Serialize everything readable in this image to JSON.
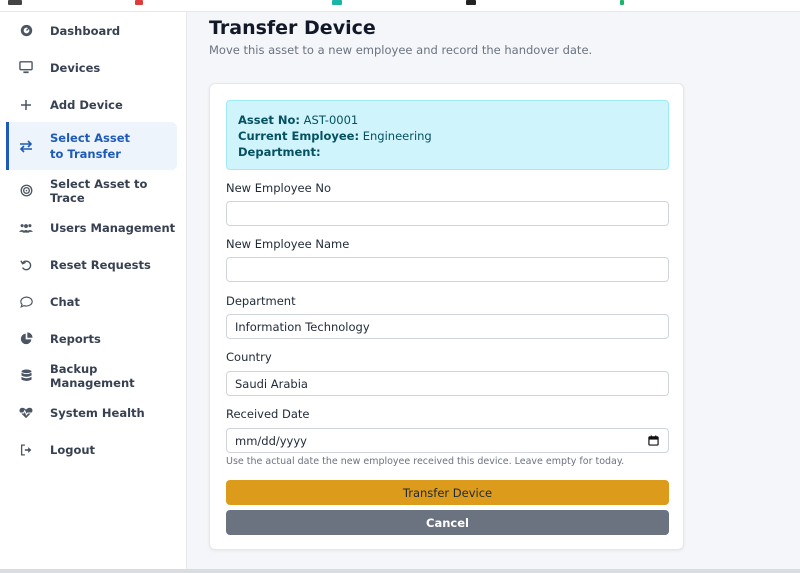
{
  "colors": {
    "accent": "#1e5bb8",
    "info_bg": "#cff4fc",
    "info_text": "#055160",
    "primary_button": "#dc9b1a",
    "secondary_button": "#6b7280"
  },
  "sidebar": {
    "items": [
      {
        "label": "Dashboard",
        "icon": "dashboard-icon"
      },
      {
        "label": "Devices",
        "icon": "monitor-icon"
      },
      {
        "label": "Add Device",
        "icon": "plus-icon"
      },
      {
        "label": "Select Asset to Transfer",
        "icon": "transfer-icon",
        "active": true
      },
      {
        "label": "Select Asset to Trace",
        "icon": "target-icon"
      },
      {
        "label": "Users Management",
        "icon": "users-icon"
      },
      {
        "label": "Reset Requests",
        "icon": "reset-icon"
      },
      {
        "label": "Chat",
        "icon": "chat-icon"
      },
      {
        "label": "Reports",
        "icon": "pie-chart-icon"
      },
      {
        "label": "Backup Management",
        "icon": "database-icon"
      },
      {
        "label": "System Health",
        "icon": "heartbeat-icon"
      },
      {
        "label": "Logout",
        "icon": "logout-icon"
      }
    ]
  },
  "page": {
    "title": "Transfer Device",
    "subtitle": "Move this asset to a new employee and record the handover date."
  },
  "asset": {
    "asset_no_label": "Asset No:",
    "asset_no": "AST-0001",
    "current_employee_label": "Current Employee:",
    "current_employee": "Engineering",
    "department_label": "Department:",
    "department": ""
  },
  "form": {
    "new_employee_no": {
      "label": "New Employee No",
      "value": ""
    },
    "new_employee_name": {
      "label": "New Employee Name",
      "value": ""
    },
    "department": {
      "label": "Department",
      "value": "Information Technology"
    },
    "country": {
      "label": "Country",
      "value": "Saudi Arabia"
    },
    "received_date": {
      "label": "Received Date",
      "placeholder": "mm/dd/yyyy",
      "help": "Use the actual date the new employee received this device. Leave empty for today."
    },
    "transfer_button": "Transfer Device",
    "cancel_button": "Cancel"
  }
}
